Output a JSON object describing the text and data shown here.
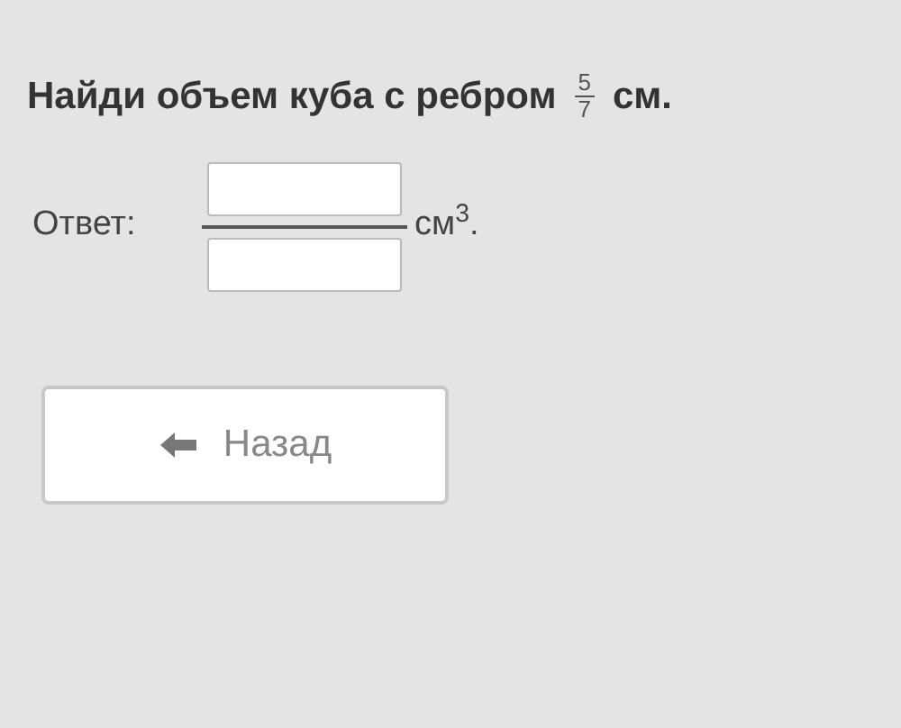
{
  "question": {
    "text": "Найди объем куба с ребром",
    "fraction": {
      "numerator": "5",
      "denominator": "7"
    },
    "unit": "см."
  },
  "answer": {
    "label": "Ответ:",
    "unit": "см$^{3}$."
  },
  "back_button": {
    "label": "Назад"
  }
}
